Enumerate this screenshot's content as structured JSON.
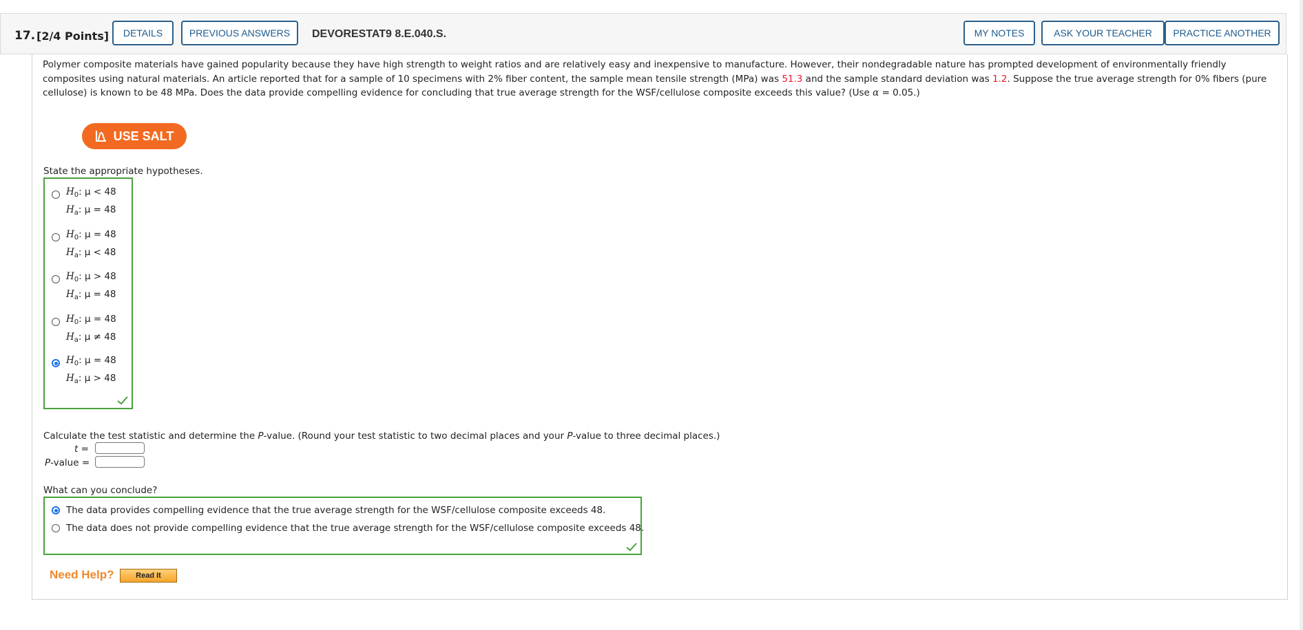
{
  "header": {
    "question_number": "17.",
    "points": "[2/4 Points]",
    "details_label": "DETAILS",
    "previous_answers_label": "PREVIOUS ANSWERS",
    "question_code": "DEVORESTAT9 8.E.040.S.",
    "my_notes_label": "MY NOTES",
    "ask_teacher_label": "ASK YOUR TEACHER",
    "practice_another_label": "PRACTICE ANOTHER",
    "button_color": "#2a5f8c"
  },
  "problem": {
    "text_1": "Polymer composite materials have gained popularity because they have high strength to weight ratios and are relatively easy and inexpensive to manufacture. However, their nondegradable nature has prompted development of environmentally friendly composites using natural materials. An article reported that for a sample of 10 specimens with 2% fiber content, the sample mean tensile strength (MPa) was ",
    "mean": "51.3",
    "text_2": " and the sample standard deviation was ",
    "sd": "1.2",
    "text_3": ". Suppose the true average strength for 0% fibers (pure cellulose) is known to be 48 MPa. Does the data provide compelling evidence for concluding that true average strength for the WSF/cellulose composite exceeds this value? (Use ",
    "alpha_symbol": "α",
    "alpha_value": " = 0.05.)",
    "highlight_color": "#e8192c"
  },
  "salt": {
    "label": "USE SALT",
    "color": "#f26a21"
  },
  "hypotheses": {
    "prompt": "State the appropriate hypotheses.",
    "selected_index": 4,
    "correct": true,
    "options": [
      {
        "h0": ": μ < 48",
        "ha": ": μ = 48"
      },
      {
        "h0": ": μ = 48",
        "ha": ": μ < 48"
      },
      {
        "h0": ": μ > 48",
        "ha": ": μ = 48"
      },
      {
        "h0": ": μ = 48",
        "ha": ": μ ≠ 48"
      },
      {
        "h0": ": μ = 48",
        "ha": ": μ > 48"
      }
    ],
    "h_symbol": "H",
    "h0_sub": "0",
    "ha_sub": "a"
  },
  "calc": {
    "prompt_1": "Calculate the test statistic and determine the ",
    "p_italic": "P",
    "prompt_2": "-value. (Round your test statistic to two decimal places and your ",
    "prompt_3": "-value to three decimal places.)",
    "t_label": "t",
    "eq": " =",
    "pvalue_label": "-value",
    "t_value": "",
    "p_value": ""
  },
  "conclusion": {
    "prompt": "What can you conclude?",
    "selected_index": 0,
    "correct": true,
    "options": [
      "The data provides compelling evidence that the true average strength for the WSF/cellulose composite exceeds 48.",
      "The data does not provide compelling evidence that the true average strength for the WSF/cellulose composite exceeds 48."
    ]
  },
  "help": {
    "need_help_label": "Need Help?",
    "read_it_label": "Read It"
  },
  "colors": {
    "correct_green": "#49a03c",
    "radio_blue": "#1a73e8"
  }
}
